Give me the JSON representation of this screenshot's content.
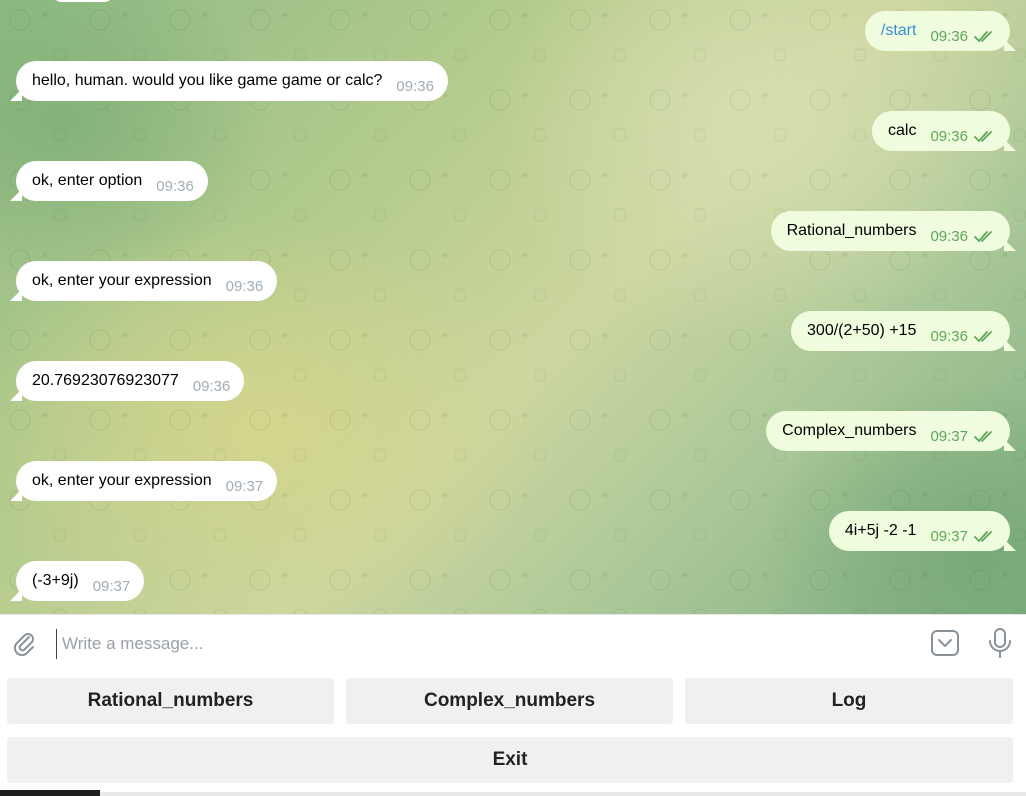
{
  "incoming": [
    {
      "text": "hello, human. would you like game game or calc?",
      "time": "09:36"
    },
    {
      "text": "ok, enter option",
      "time": "09:36"
    },
    {
      "text": "ok, enter your expression",
      "time": "09:36"
    },
    {
      "text": "20.76923076923077",
      "time": "09:36"
    },
    {
      "text": "ok, enter your expression",
      "time": "09:37"
    },
    {
      "text": "(-3+9j)",
      "time": "09:37"
    }
  ],
  "outgoing": [
    {
      "text": "/start",
      "time": "09:36"
    },
    {
      "text": "calc",
      "time": "09:36"
    },
    {
      "text": "Rational_numbers",
      "time": "09:36"
    },
    {
      "text": "300/(2+50) +15",
      "time": "09:36"
    },
    {
      "text": "Complex_numbers",
      "time": "09:37"
    },
    {
      "text": "4i+5j -2 -1",
      "time": "09:37"
    }
  ],
  "composer": {
    "placeholder": "Write a message..."
  },
  "keyboard": {
    "rows": [
      [
        "Rational_numbers",
        "Complex_numbers",
        "Log"
      ],
      [
        "Exit"
      ]
    ]
  },
  "colors": {
    "outgoing_bubble": "#effdde",
    "incoming_bubble": "#ffffff",
    "read_checks": "#5fa55a",
    "command_link": "#3a8fd0"
  },
  "icons": [
    "paperclip-icon",
    "bot-keyboard-icon",
    "microphone-icon",
    "double-check-icon"
  ]
}
